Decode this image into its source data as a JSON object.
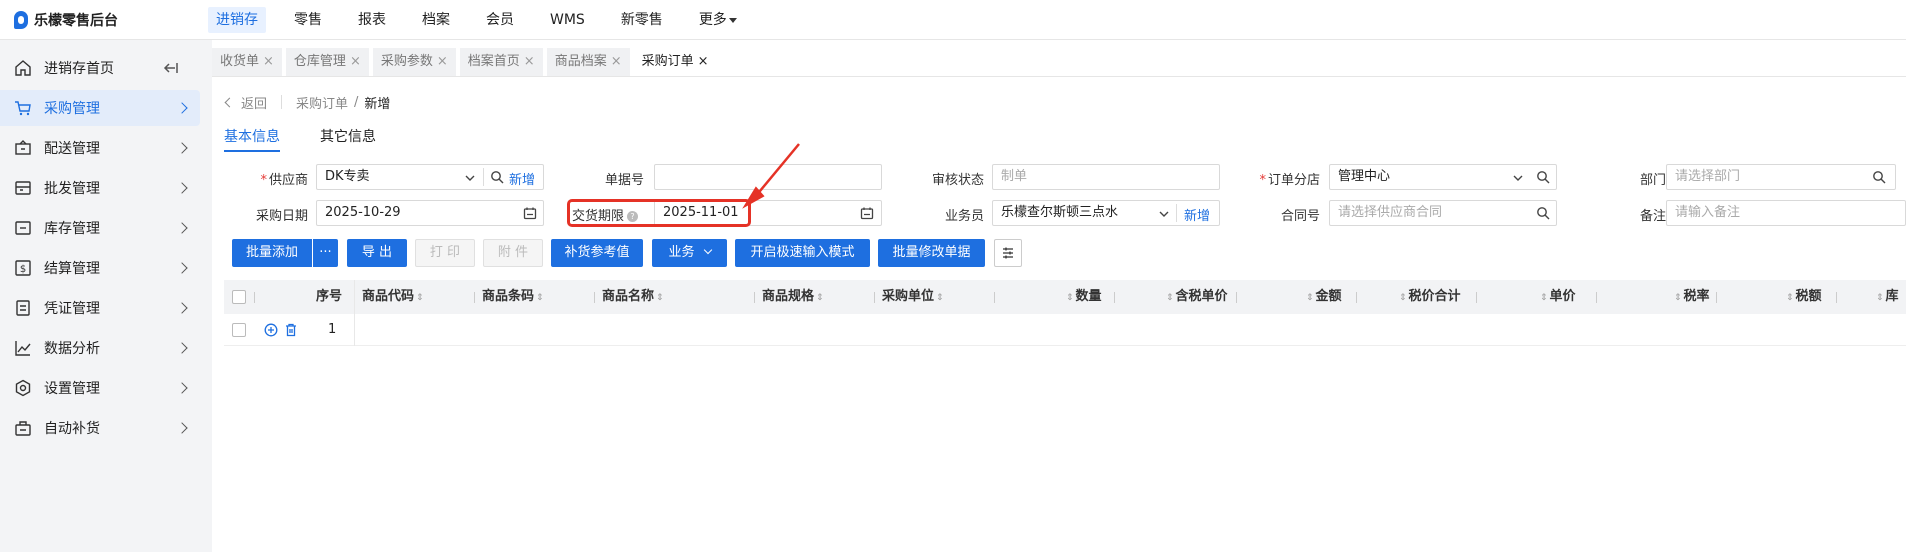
{
  "app": {
    "title": "乐檬零售后台",
    "logo_icon": "leimeng-logo-icon"
  },
  "topnav": {
    "items": [
      "进销存",
      "零售",
      "报表",
      "档案",
      "会员",
      "WMS",
      "新零售",
      "更多"
    ],
    "active": "进销存"
  },
  "sidebar": {
    "items": [
      {
        "label": "进销存首页",
        "icon": "home-icon"
      },
      {
        "label": "采购管理",
        "icon": "cart-icon",
        "active": true
      },
      {
        "label": "配送管理",
        "icon": "delivery-icon"
      },
      {
        "label": "批发管理",
        "icon": "wholesale-icon"
      },
      {
        "label": "库存管理",
        "icon": "inventory-icon"
      },
      {
        "label": "结算管理",
        "icon": "settlement-icon"
      },
      {
        "label": "凭证管理",
        "icon": "voucher-icon"
      },
      {
        "label": "数据分析",
        "icon": "chart-icon"
      },
      {
        "label": "设置管理",
        "icon": "settings-icon"
      },
      {
        "label": "自动补货",
        "icon": "replenish-icon"
      }
    ]
  },
  "tabs": [
    {
      "label": "收货单",
      "close": "×"
    },
    {
      "label": "仓库管理",
      "close": "×"
    },
    {
      "label": "采购参数",
      "close": "×"
    },
    {
      "label": "档案首页",
      "close": "×"
    },
    {
      "label": "商品档案",
      "close": "×"
    },
    {
      "label": "采购订单",
      "close": "×",
      "active": true
    }
  ],
  "breadcrumb": {
    "back": "返回",
    "parent": "采购订单",
    "separator": "/",
    "current": "新增"
  },
  "subtabs": [
    "基本信息",
    "其它信息"
  ],
  "form": {
    "supplier": {
      "label": "供应商",
      "value": "DK专卖",
      "add": "新增"
    },
    "doc_no": {
      "label": "单据号",
      "value": ""
    },
    "audit_status": {
      "label": "审核状态",
      "placeholder": "制单"
    },
    "order_branch": {
      "label": "订单分店",
      "value": "管理中心"
    },
    "department": {
      "label": "部门",
      "placeholder": "请选择部门"
    },
    "purchase_date": {
      "label": "采购日期",
      "value": "2025-10-29"
    },
    "delivery_deadline": {
      "label": "交货期限",
      "value": "2025-11-01",
      "help": "?"
    },
    "salesman": {
      "label": "业务员",
      "value": "乐檬查尔斯顿三点水",
      "add": "新增"
    },
    "contract_no": {
      "label": "合同号",
      "placeholder": "请选择供应商合同"
    },
    "remark": {
      "label": "备注",
      "placeholder": "请输入备注"
    }
  },
  "toolbar": {
    "batch_add": "批量添加",
    "more": "···",
    "export": "导 出",
    "print": "打 印",
    "attach": "附 件",
    "replenish_ref": "补货参考值",
    "business": "业务",
    "fast_input": "开启极速输入模式",
    "batch_modify": "批量修改单据"
  },
  "table": {
    "columns": [
      "序号",
      "商品代码",
      "商品条码",
      "商品名称",
      "商品规格",
      "采购单位",
      "数量",
      "含税单价",
      "金额",
      "税价合计",
      "单价",
      "税率",
      "税额",
      "库"
    ],
    "rows": [
      {
        "index": "1"
      }
    ]
  },
  "colors": {
    "accent": "#1e6fe0",
    "highlight": "#e53226",
    "sidebar_bg": "#f3f4f6"
  }
}
